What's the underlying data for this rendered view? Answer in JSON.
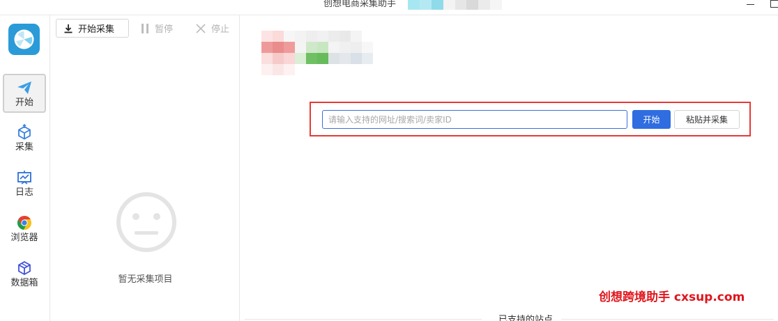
{
  "window": {
    "title": "创想电商采集助手",
    "title_blur_colors": [
      "#a7e7f2",
      "#b4e9f4",
      "#8fdbe9",
      "#f3f3f3",
      "#e6e6e6",
      "#d9d9d9",
      "#ebebeb",
      "#f5f5f5"
    ]
  },
  "rail": {
    "items": [
      {
        "label": "开始",
        "icon": "paper-plane-icon",
        "active": true
      },
      {
        "label": "采集",
        "icon": "cube-upload-icon",
        "active": false
      },
      {
        "label": "日志",
        "icon": "chart-board-icon",
        "active": false
      },
      {
        "label": "浏览器",
        "icon": "chrome-icon",
        "active": false
      },
      {
        "label": "数据箱",
        "icon": "box-icon",
        "active": false
      }
    ]
  },
  "panel": {
    "start_label": "开始采集",
    "pause_label": "暂停",
    "stop_label": "停止",
    "empty_text": "暂无采集项目"
  },
  "main": {
    "input_placeholder": "请输入支持的网址/搜索词/卖家ID",
    "input_value": "",
    "start_button": "开始",
    "paste_button": "粘贴并采集",
    "watermark": "创想跨境助手 cxsup.com",
    "sites_label": "已支持的站点"
  },
  "colors": {
    "accent": "#2f6de1",
    "highlight": "#e53935",
    "watermark": "#e0151c"
  }
}
